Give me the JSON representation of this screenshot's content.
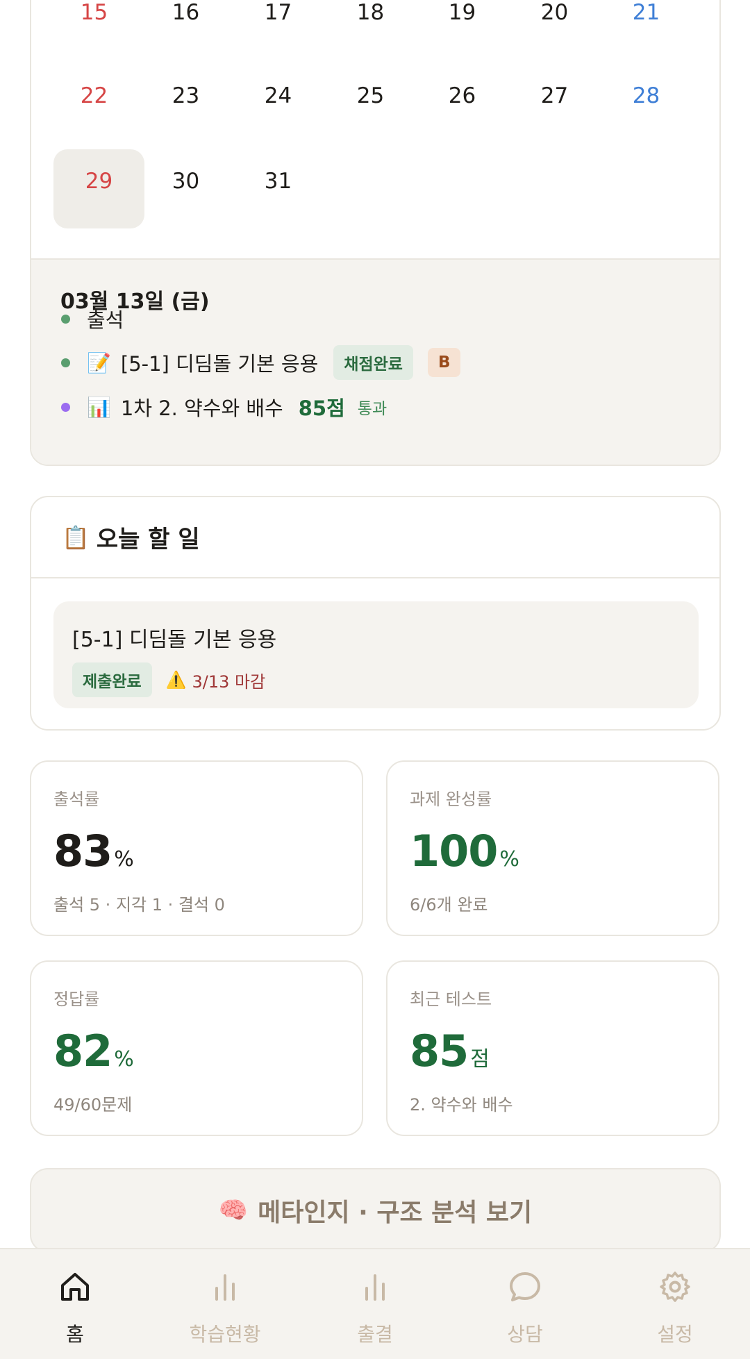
{
  "calendar": {
    "rows": [
      [
        {
          "d": "15",
          "type": "sun"
        },
        {
          "d": "16",
          "type": ""
        },
        {
          "d": "17",
          "type": ""
        },
        {
          "d": "18",
          "type": ""
        },
        {
          "d": "19",
          "type": ""
        },
        {
          "d": "20",
          "type": ""
        },
        {
          "d": "21",
          "type": "sat"
        }
      ],
      [
        {
          "d": "22",
          "type": "sun"
        },
        {
          "d": "23",
          "type": ""
        },
        {
          "d": "24",
          "type": ""
        },
        {
          "d": "25",
          "type": ""
        },
        {
          "d": "26",
          "type": ""
        },
        {
          "d": "27",
          "type": ""
        },
        {
          "d": "28",
          "type": "sat"
        }
      ],
      [
        {
          "d": "29",
          "type": "sun",
          "today": true
        },
        {
          "d": "30",
          "type": ""
        },
        {
          "d": "31",
          "type": ""
        }
      ]
    ],
    "selected_date": "03월 13일 (금)",
    "events": {
      "attendance": "출석",
      "assignment": {
        "emoji": "📝",
        "title": "[5-1] 디딤돌 기본 응용",
        "status": "채점완료",
        "grade": "B"
      },
      "test": {
        "emoji": "📊",
        "title": "1차 2. 약수와 배수",
        "score": "85점",
        "result": "통과"
      }
    }
  },
  "today": {
    "emoji": "📋",
    "title": "오늘 할 일",
    "task": {
      "title": "[5-1] 디딤돌 기본 응용",
      "status": "제출완료",
      "warn_emoji": "⚠️",
      "deadline": "3/13 마감"
    }
  },
  "stats": {
    "attendance": {
      "label": "출석률",
      "value": "83",
      "unit": "%",
      "sub": "출석 5 · 지각 1 · 결석 0"
    },
    "completion": {
      "label": "과제 완성률",
      "value": "100",
      "unit": "%",
      "sub": "6/6개 완료"
    },
    "accuracy": {
      "label": "정답률",
      "value": "82",
      "unit": "%",
      "sub": "49/60문제"
    },
    "recent_test": {
      "label": "최근 테스트",
      "value": "85",
      "unit": "점",
      "sub": "2. 약수와 배수"
    }
  },
  "meta_button": {
    "emoji": "🧠",
    "label": "메타인지 · 구조 분석 보기"
  },
  "nav": {
    "home": "홈",
    "study": "학습현황",
    "attendance": "출결",
    "counsel": "상담",
    "settings": "설정"
  },
  "colors": {
    "accent_green": "#1f6b3a",
    "sunday": "#d64545",
    "saturday": "#3f7fd6",
    "nav_inactive": "#c8b9a6"
  }
}
